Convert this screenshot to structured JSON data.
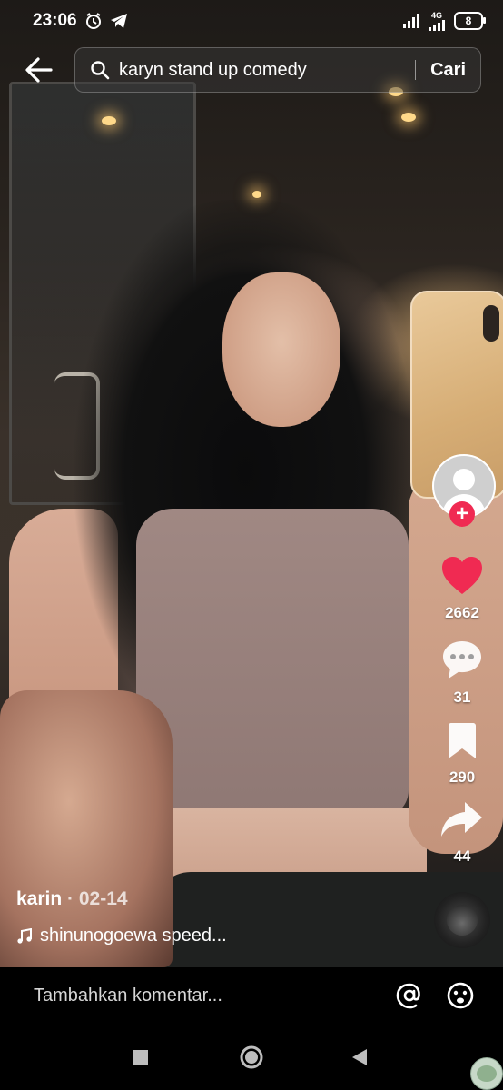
{
  "status_bar": {
    "time": "23:06",
    "network": "4G",
    "battery": "8"
  },
  "search": {
    "query": "karyn stand up comedy",
    "button": "Cari"
  },
  "actions": {
    "likes": "2662",
    "comments": "31",
    "saves": "290",
    "shares": "44"
  },
  "caption": {
    "author": "karin",
    "date": "· 02-14",
    "sound": "shinunogoewa speed..."
  },
  "comment_bar": {
    "placeholder": "Tambahkan komentar..."
  },
  "colors": {
    "like": "#f02a52",
    "follow": "#f02a52"
  },
  "icons": [
    "back-arrow-icon",
    "search-icon",
    "heart-icon",
    "comment-icon",
    "bookmark-icon",
    "share-icon",
    "music-note-icon",
    "mention-icon",
    "emoji-icon"
  ]
}
